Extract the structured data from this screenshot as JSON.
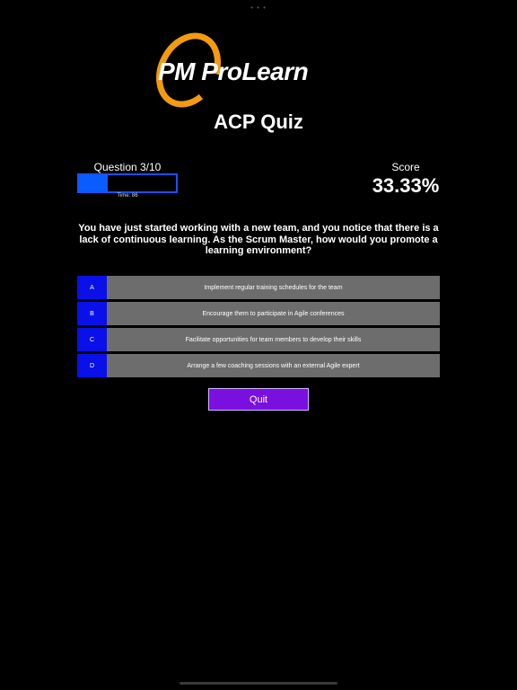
{
  "status_dots": "• • •",
  "logo": {
    "text": "PM ProLearn"
  },
  "quiz": {
    "title": "ACP Quiz"
  },
  "progress": {
    "question_label": "Question 3/10",
    "fraction": 0.3,
    "time_label": "Time: 86"
  },
  "score": {
    "label": "Score",
    "value": "33.33%"
  },
  "question": {
    "text": "You have just started working with a new team, and you notice that there is a lack of continuous learning. As the Scrum Master, how would you promote a learning environment?"
  },
  "answers": [
    {
      "letter": "A",
      "text": "Implement regular training schedules for the team"
    },
    {
      "letter": "B",
      "text": "Encourage them to participate in Agile conferences"
    },
    {
      "letter": "C",
      "text": "Facilitate opportunities for team members to develop their skills"
    },
    {
      "letter": "D",
      "text": "Arrange a few coaching sessions with an external Agile expert"
    }
  ],
  "quit": {
    "label": "Quit"
  },
  "colors": {
    "background": "#000000",
    "progress_fill": "#0a5cff",
    "answer_letter_bg": "#0a10e8",
    "answer_text_bg": "#6d6d6d",
    "quit_bg": "#7a10e0",
    "logo_ring": "#f29a12"
  }
}
